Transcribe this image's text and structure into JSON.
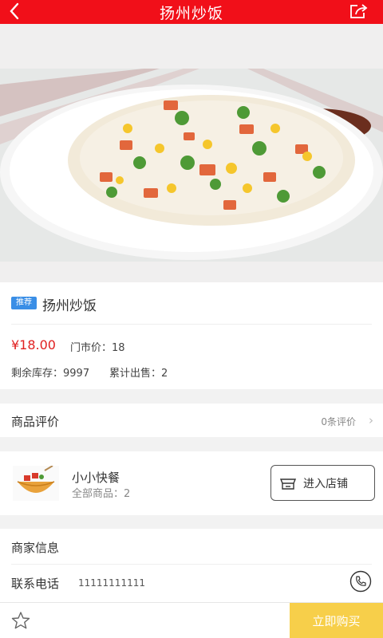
{
  "header": {
    "title": "扬州炒饭",
    "back_icon": "chevron-left-icon",
    "share_icon": "share-icon"
  },
  "product": {
    "badge": "推荐",
    "name": "扬州炒饭",
    "price": "¥18.00",
    "market_price": "门市价：18",
    "stock": "剩余库存：9997",
    "sold": "累计出售：2"
  },
  "reviews": {
    "label": "商品评价",
    "count": "0条评价"
  },
  "store": {
    "name": "小小快餐",
    "all_goods": "全部商品：2",
    "enter_label": "进入店铺"
  },
  "merchant": {
    "heading": "商家信息",
    "phone_label": "联系电话",
    "phone_value": "11111111111"
  },
  "bottom_bar": {
    "buy_label": "立即购买",
    "favorite_icon": "star-icon"
  },
  "colors": {
    "header_red": "#f10f19",
    "price_red": "#e02020",
    "buy_yellow": "#f7cf4a",
    "badge_blue": "#3a8ee6"
  }
}
